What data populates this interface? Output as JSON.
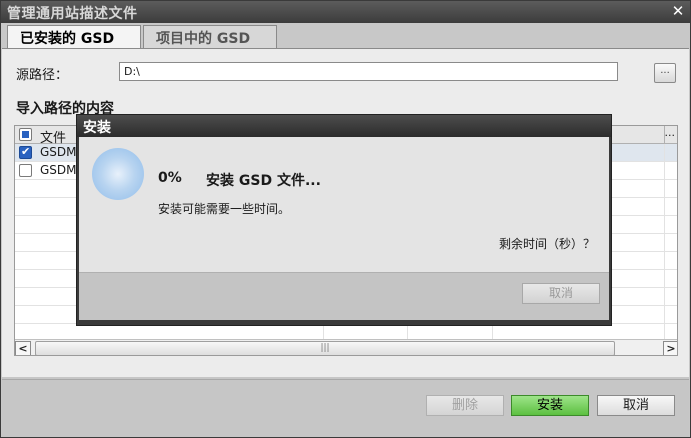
{
  "window": {
    "title": "管理通用站描述文件",
    "close_glyph": "✕"
  },
  "tabs": [
    {
      "label": "已安装的 GSD",
      "active": true
    },
    {
      "label": "项目中的 GSD",
      "active": false
    }
  ],
  "source": {
    "label": "源路径：",
    "value": "D:\\",
    "browse_label": "..."
  },
  "section_title": "导入路径的内容",
  "grid": {
    "header": {
      "label": "文件",
      "more": "..."
    },
    "rows": [
      {
        "text": "GSDM",
        "checked": true,
        "selected": true
      },
      {
        "text": "GSDM",
        "checked": false,
        "selected": false
      }
    ],
    "scroll_left": "<",
    "scroll_right": ">",
    "scroll_grip": "|||"
  },
  "footer": {
    "delete_label": "删除",
    "install_label": "安装",
    "cancel_label": "取消"
  },
  "progress_dialog": {
    "title": "安装",
    "percent": "0%",
    "message": "安装 GSD 文件...",
    "subtext": "安装可能需要一些时间。",
    "remaining": "剩余时间（秒）？",
    "cancel_label": "取消"
  },
  "colors": {
    "install_button": "#5cc040",
    "checkbox_checked": "#2a62c0"
  }
}
